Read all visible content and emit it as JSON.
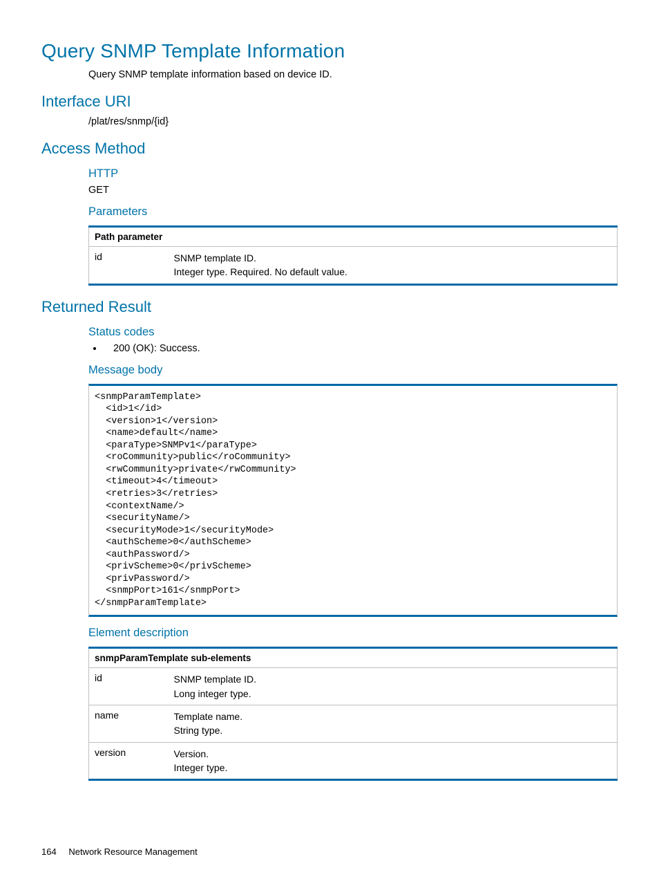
{
  "title": "Query SNMP Template Information",
  "intro": "Query SNMP template information based on device ID.",
  "interface_uri": {
    "heading": "Interface URI",
    "path": "/plat/res/snmp/{id}"
  },
  "access_method": {
    "heading": "Access Method",
    "http_heading": "HTTP",
    "http_verb": "GET",
    "parameters_heading": "Parameters",
    "path_table": {
      "header": "Path parameter",
      "rows": [
        {
          "name": "id",
          "line1": "SNMP template ID.",
          "line2": "Integer type. Required. No default value."
        }
      ]
    }
  },
  "returned_result": {
    "heading": "Returned Result",
    "status_codes_heading": "Status codes",
    "status_codes": [
      "200 (OK): Success."
    ],
    "message_body_heading": "Message body",
    "message_body": "<snmpParamTemplate>\n  <id>1</id>\n  <version>1</version>\n  <name>default</name>\n  <paraType>SNMPv1</paraType>\n  <roCommunity>public</roCommunity>\n  <rwCommunity>private</rwCommunity>\n  <timeout>4</timeout>\n  <retries>3</retries>\n  <contextName/>\n  <securityName/>\n  <securityMode>1</securityMode>\n  <authScheme>0</authScheme>\n  <authPassword/>\n  <privScheme>0</privScheme>\n  <privPassword/>\n  <snmpPort>161</snmpPort>\n</snmpParamTemplate>",
    "element_desc_heading": "Element description",
    "element_table": {
      "header": "snmpParamTemplate sub-elements",
      "rows": [
        {
          "name": "id",
          "line1": "SNMP template ID.",
          "line2": "Long integer type."
        },
        {
          "name": "name",
          "line1": "Template name.",
          "line2": "String type."
        },
        {
          "name": "version",
          "line1": "Version.",
          "line2": "Integer type."
        }
      ]
    }
  },
  "footer": {
    "page_number": "164",
    "section": "Network Resource Management"
  }
}
